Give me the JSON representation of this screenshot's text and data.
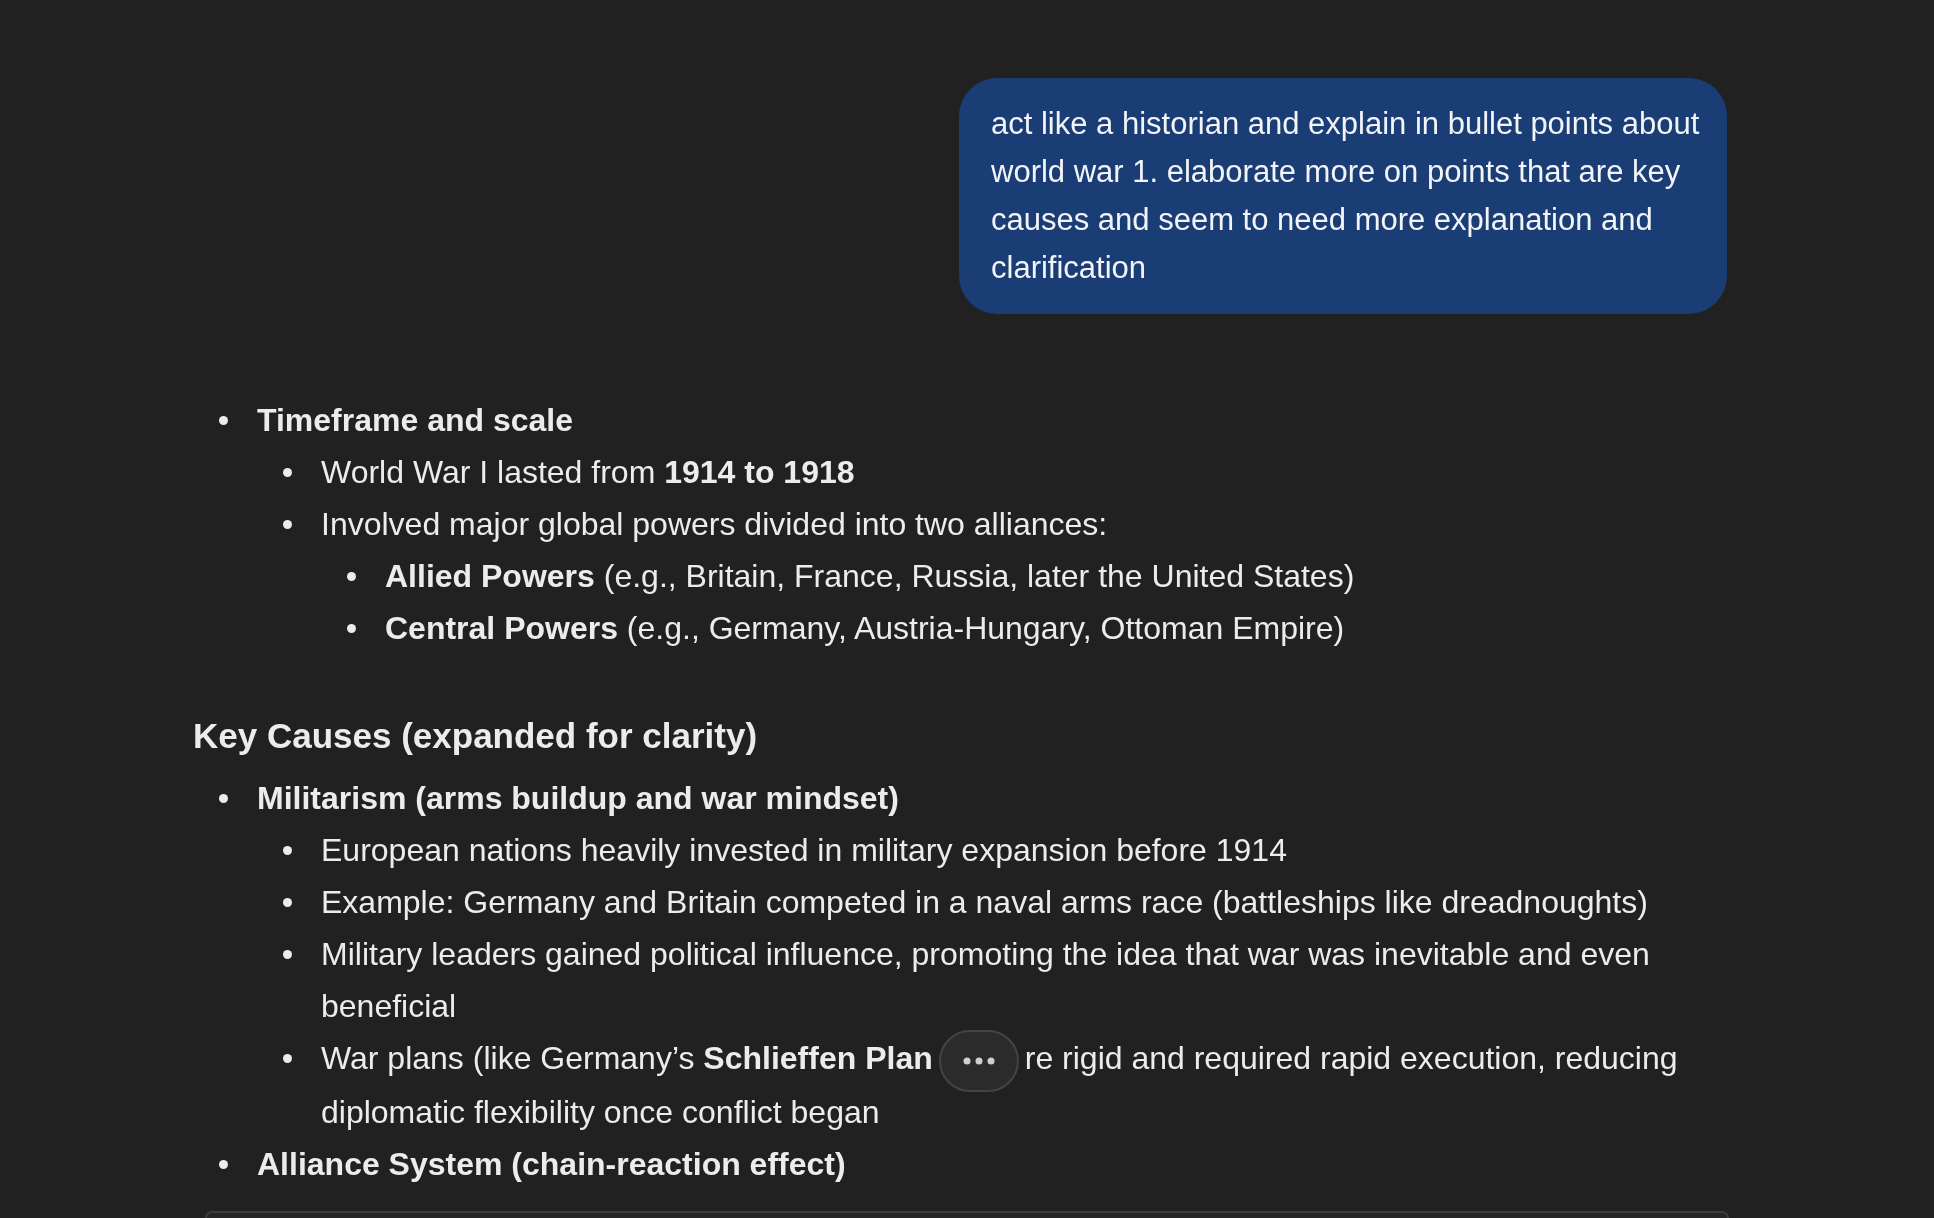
{
  "user_message": {
    "text": "act like a historian and explain in bullet points about world war 1. elaborate more on points that are key causes and seem to need more explanation and clarification"
  },
  "response": [
    {
      "kind": "list",
      "items": [
        {
          "kind": "text",
          "text": "Timeframe and scale",
          "children": [
            {
              "kind": "text",
              "text": "World War I lasted from **1914 to 1918**"
            },
            {
              "kind": "text",
              "text": "Involved major global powers divided into two alliances:",
              "children": [
                {
                  "kind": "text",
                  "text": "**Allied Powers** (e.g., Britain, France, Russia, later the United States)"
                },
                {
                  "kind": "text",
                  "text": "**Central Powers** (e.g., Germany, Austria-Hungary, Ottoman Empire)"
                }
              ]
            }
          ]
        }
      ]
    },
    {
      "kind": "heading",
      "text": "Key Causes (expanded for clarity)"
    },
    {
      "kind": "list",
      "items": [
        {
          "kind": "text",
          "text": "Militarism (arms buildup and war mindset)",
          "children": [
            {
              "kind": "text",
              "text": "European nations heavily invested in military expansion before 1914"
            },
            {
              "kind": "text",
              "text": "Example: Germany and Britain competed in a naval arms race (battleships like dreadnoughts)"
            },
            {
              "kind": "text",
              "text": "Military leaders gained political influence, promoting the idea that war was inevitable and even beneficial"
            },
            {
              "kind": "split",
              "text": "War plans (like Germany’s **Schlieffen Plan**",
              "continuation": "re rigid and required rapid execution, reducing",
              "last_line": "diplomatic flexibility once conflict began"
            }
          ]
        },
        {
          "kind": "text",
          "text": "Alliance System (chain-reaction effect)"
        }
      ]
    }
  ]
}
